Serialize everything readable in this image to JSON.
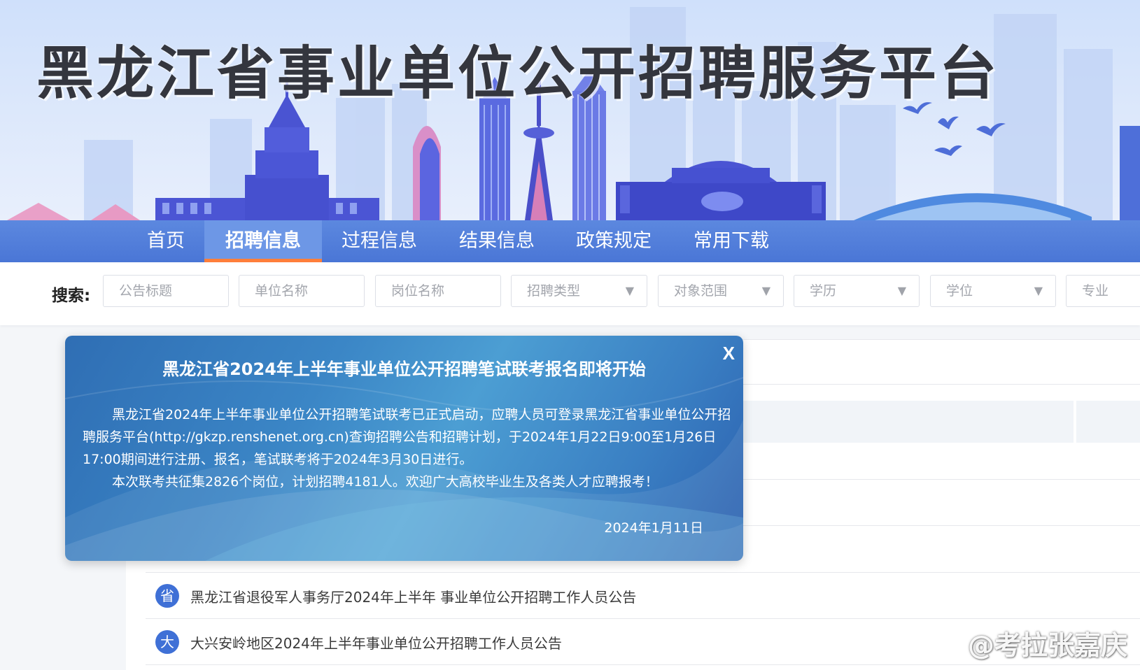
{
  "site": {
    "title": "黑龙江省事业单位公开招聘服务平台"
  },
  "nav": {
    "items": [
      {
        "label": "首页"
      },
      {
        "label": "招聘信息",
        "active": true
      },
      {
        "label": "过程信息"
      },
      {
        "label": "结果信息"
      },
      {
        "label": "政策规定"
      },
      {
        "label": "常用下载"
      }
    ]
  },
  "search": {
    "label": "搜索:",
    "title_placeholder": "公告标题",
    "unit_placeholder": "单位名称",
    "post_placeholder": "岗位名称",
    "recruit_type": "招聘类型",
    "target_scope": "对象范围",
    "education": "学历",
    "degree": "学位",
    "major": "专业"
  },
  "popup": {
    "close": "X",
    "title": "黑龙江省2024年上半年事业单位公开招聘笔试联考报名即将开始",
    "paragraph1": "黑龙江省2024年上半年事业单位公开招聘笔试联考已正式启动，应聘人员可登录黑龙江省事业单位公开招聘服务平台(http://gkzp.renshenet.org.cn)查询招聘公告和招聘计划，于2024年1月22日9:00至1月26日17:00期间进行注册、报名，笔试联考将于2024年3月30日进行。",
    "paragraph2": "本次联考共征集2826个岗位，计划招聘4181人。欢迎广大高校毕业生及各类人才应聘报考！",
    "date": "2024年1月11日"
  },
  "list": {
    "items": [
      {
        "badge": "省",
        "text": "黑龙江省退役军人事务厅2024年上半年 事业单位公开招聘工作人员公告"
      },
      {
        "badge": "大",
        "text": "大兴安岭地区2024年上半年事业单位公开招聘工作人员公告"
      }
    ]
  },
  "watermark": {
    "text": "@考拉张嘉庆",
    "icon": "weibo-icon"
  },
  "colors": {
    "nav": "#4a76d6",
    "active_underline": "#ff7f3a",
    "badge": "#3f70d6",
    "popup": "#3b86c6"
  }
}
